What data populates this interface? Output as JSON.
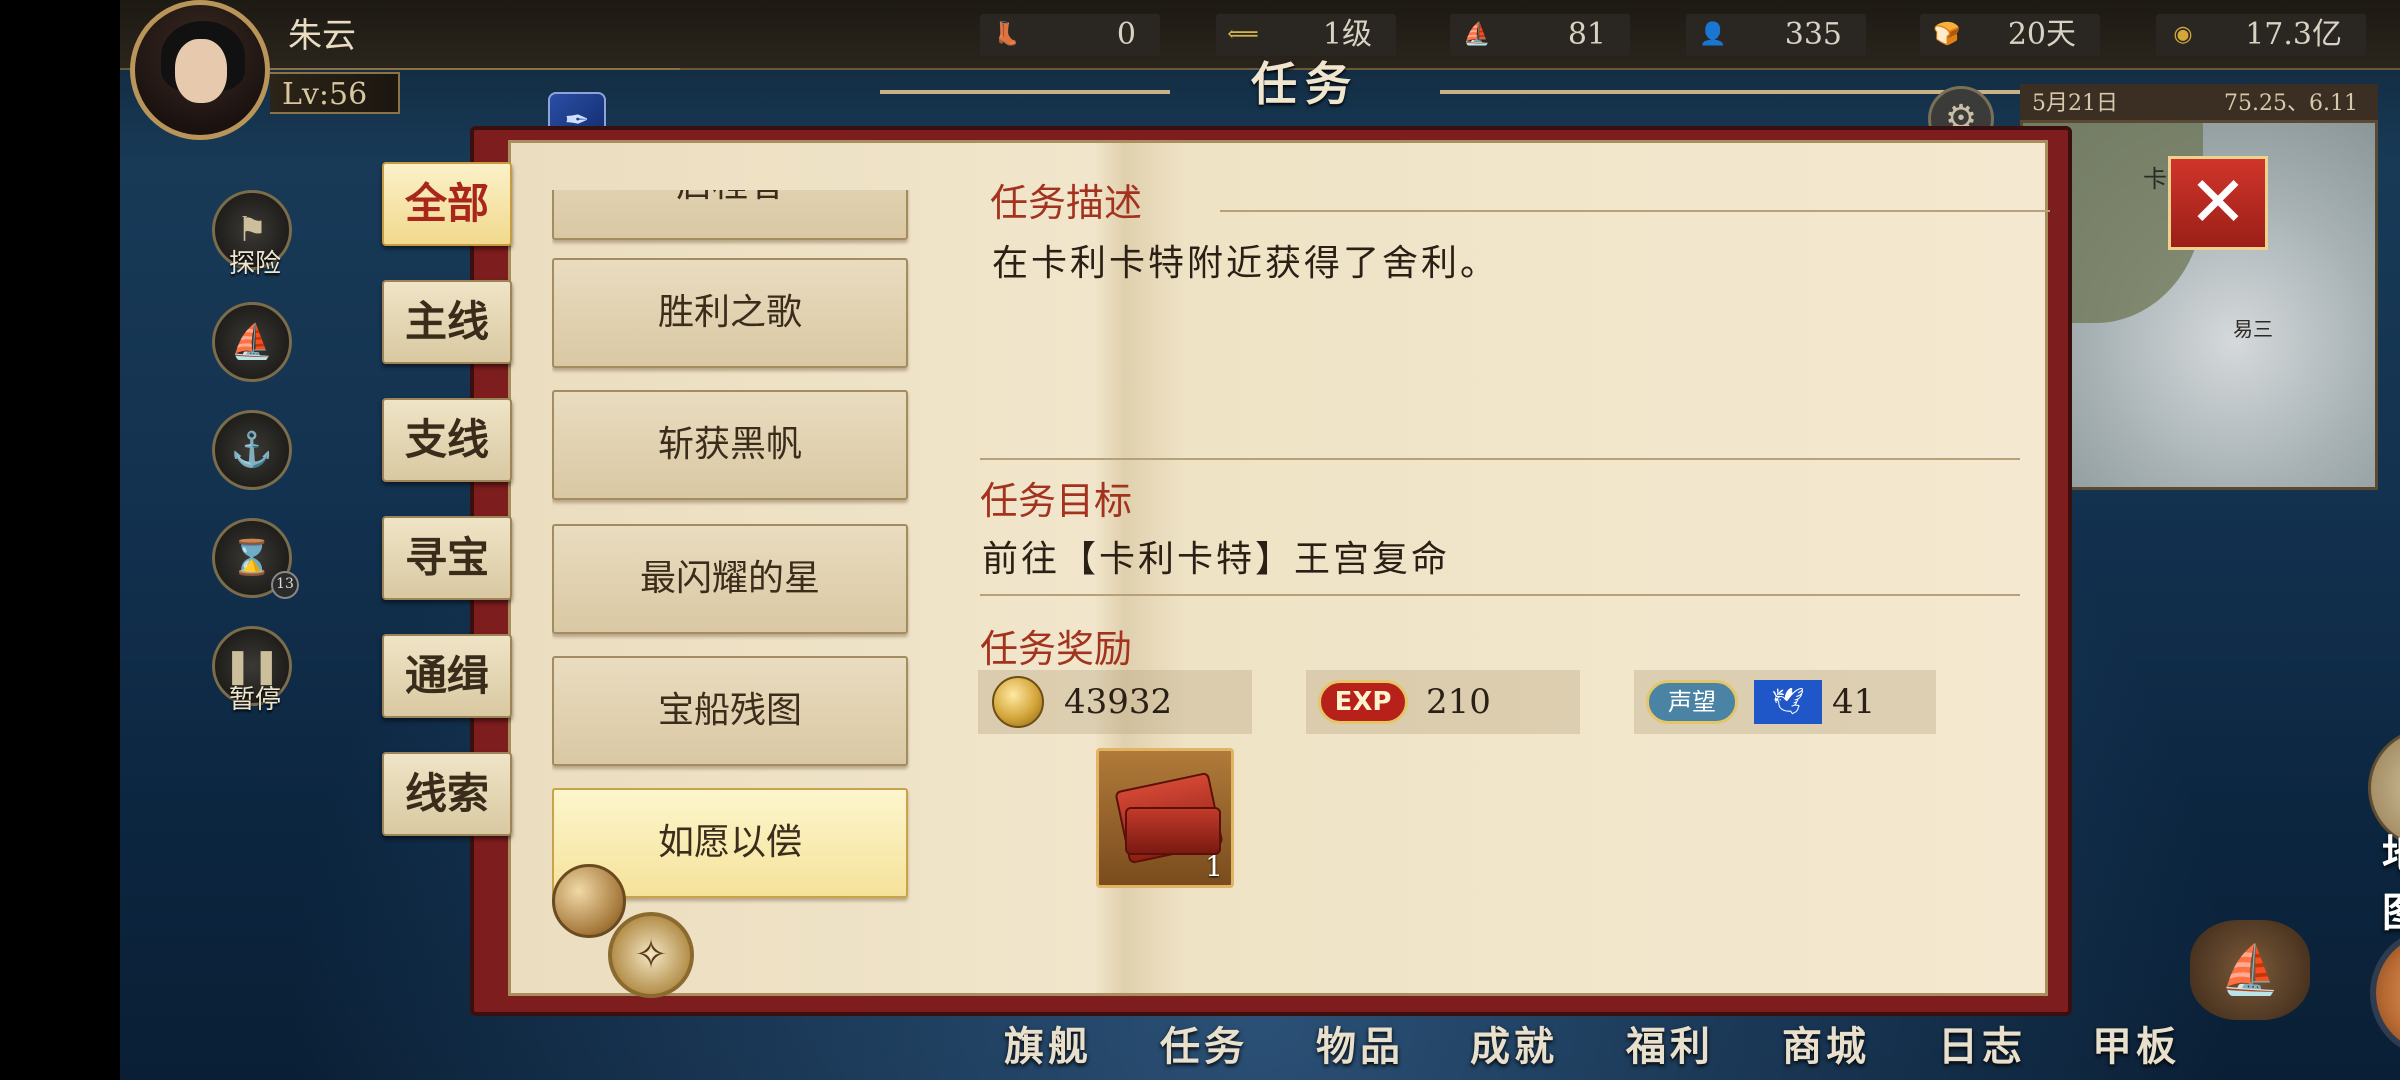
{
  "player": {
    "name": "朱云",
    "level": "Lv:56"
  },
  "resources": [
    {
      "icon": "boot-icon",
      "glyph": "👢",
      "value": "0"
    },
    {
      "icon": "rank-icon",
      "glyph": "⟸",
      "value": "1级"
    },
    {
      "icon": "ship-icon",
      "glyph": "⛵",
      "value": "81"
    },
    {
      "icon": "sailor-icon",
      "glyph": "👤",
      "value": "335"
    },
    {
      "icon": "bread-icon",
      "glyph": "🍞",
      "value": "20天"
    },
    {
      "icon": "coin-icon",
      "glyph": "◉",
      "value": "17.3亿"
    }
  ],
  "panel_title": "任务",
  "left_icons": [
    {
      "icon": "explore-flag-icon",
      "glyph": "⚑",
      "label": "探险"
    },
    {
      "icon": "sail-icon",
      "glyph": "⛵",
      "label": ""
    },
    {
      "icon": "anchor-icon",
      "glyph": "⚓",
      "label": ""
    },
    {
      "icon": "hourglass-icon",
      "glyph": "⌛",
      "label": "",
      "badge": "13"
    },
    {
      "icon": "pause-icon",
      "glyph": "❚❚",
      "label": "暂停"
    }
  ],
  "minimap": {
    "date": "5月21日",
    "coords": "75.25、6.11",
    "labels": [
      "卡特",
      "易三"
    ]
  },
  "tabs": [
    "全部",
    "主线",
    "支线",
    "寻宝",
    "通缉",
    "线索"
  ],
  "active_tab": "全部",
  "quest_list": {
    "partial": "启程者",
    "items": [
      "胜利之歌",
      "斩获黑帆",
      "最闪耀的星",
      "宝船残图",
      "如愿以偿"
    ],
    "active": "如愿以偿"
  },
  "detail": {
    "description_title": "任务描述",
    "description": "在卡利卡特附近获得了舍利。",
    "goal_title": "任务目标",
    "goal": "前往【卡利卡特】王宫复命",
    "reward_title": "任务奖励",
    "rewards": {
      "gold": "43932",
      "exp_label": "EXP",
      "exp": "210",
      "reputation_label": "声望",
      "reputation": "41"
    },
    "item": {
      "icon": "red-books-icon",
      "quantity": "1"
    }
  },
  "bottom_nav": [
    "旗舰",
    "任务",
    "物品",
    "成就",
    "福利",
    "商城",
    "日志",
    "甲板"
  ],
  "map_button": "地图",
  "colors": {
    "accent_red": "#a3331f",
    "close_red": "#d0352b",
    "gold": "#d4a63a"
  }
}
